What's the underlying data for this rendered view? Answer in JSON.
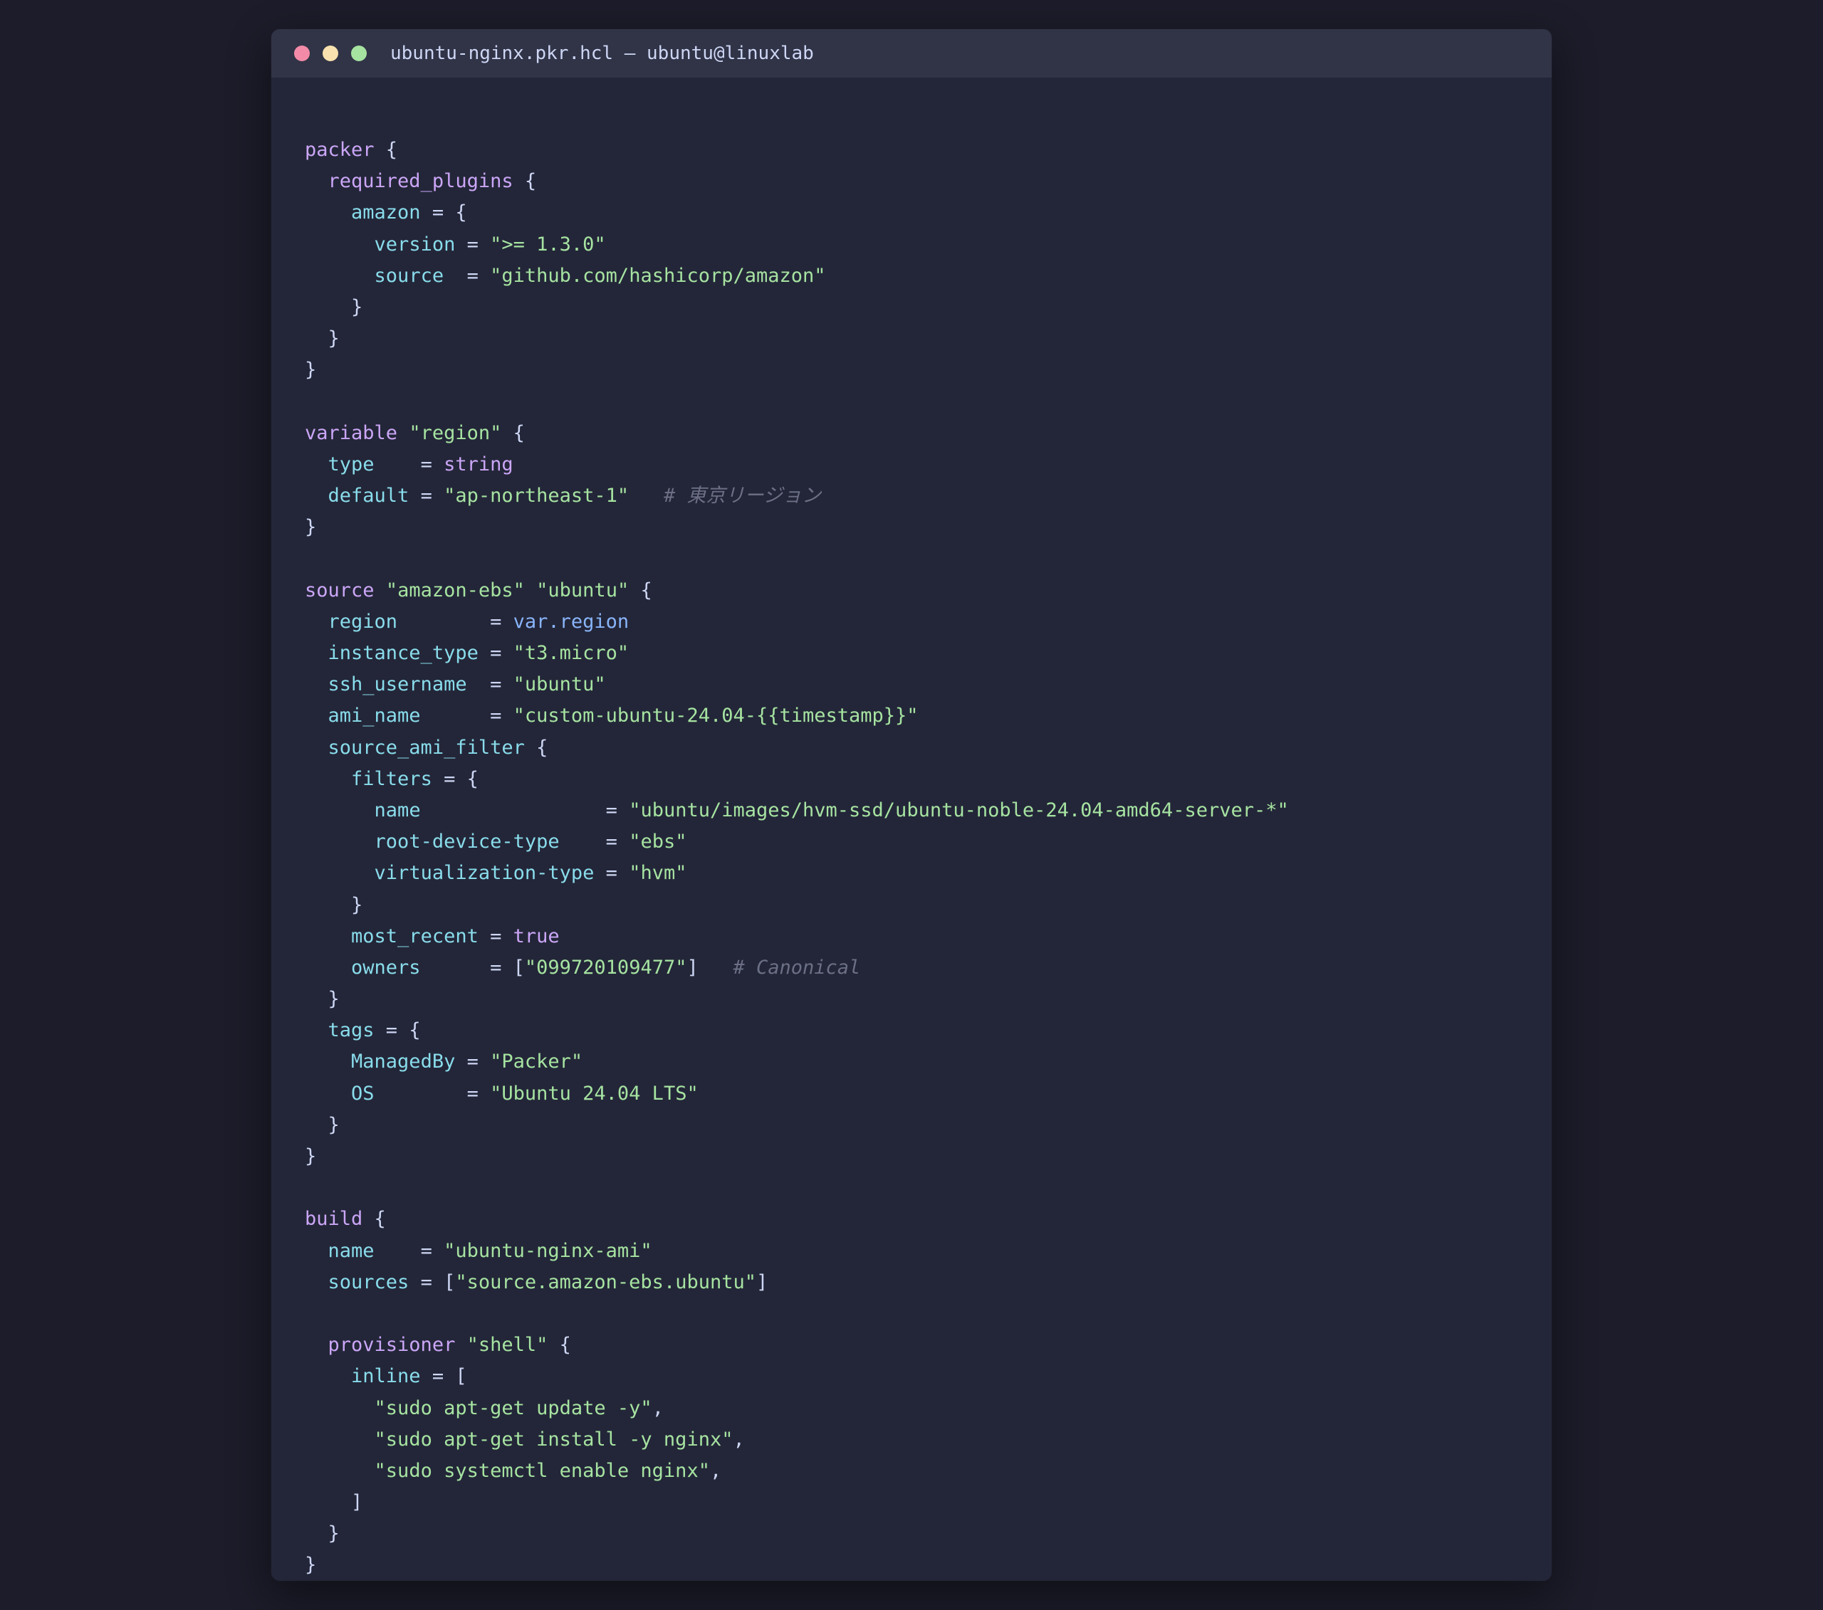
{
  "window": {
    "title": "ubuntu-nginx.pkr.hcl — ubuntu@linuxlab"
  },
  "colors": {
    "background": "#1c1c2a",
    "window": "#232638",
    "titlebar": "#313447",
    "keyword": "#cba6f7",
    "key": "#89dceb",
    "string": "#a6e3a1",
    "reference": "#89b4fa",
    "comment": "#6c7086",
    "text": "#cdd6f4"
  },
  "code": {
    "lines": [
      [
        {
          "t": "kw",
          "v": "packer"
        },
        {
          "t": "punct",
          "v": " {"
        }
      ],
      [
        {
          "t": "punct",
          "v": "  "
        },
        {
          "t": "kw",
          "v": "required_plugins"
        },
        {
          "t": "punct",
          "v": " {"
        }
      ],
      [
        {
          "t": "punct",
          "v": "    "
        },
        {
          "t": "key",
          "v": "amazon"
        },
        {
          "t": "punct",
          "v": " = {"
        }
      ],
      [
        {
          "t": "punct",
          "v": "      "
        },
        {
          "t": "key",
          "v": "version"
        },
        {
          "t": "punct",
          "v": " = "
        },
        {
          "t": "str",
          "v": "\">= 1.3.0\""
        }
      ],
      [
        {
          "t": "punct",
          "v": "      "
        },
        {
          "t": "key",
          "v": "source"
        },
        {
          "t": "punct",
          "v": "  = "
        },
        {
          "t": "str",
          "v": "\"github.com/hashicorp/amazon\""
        }
      ],
      [
        {
          "t": "punct",
          "v": "    }"
        }
      ],
      [
        {
          "t": "punct",
          "v": "  }"
        }
      ],
      [
        {
          "t": "punct",
          "v": "}"
        }
      ],
      [],
      [
        {
          "t": "kw",
          "v": "variable"
        },
        {
          "t": "punct",
          "v": " "
        },
        {
          "t": "str",
          "v": "\"region\""
        },
        {
          "t": "punct",
          "v": " {"
        }
      ],
      [
        {
          "t": "punct",
          "v": "  "
        },
        {
          "t": "key",
          "v": "type"
        },
        {
          "t": "punct",
          "v": "    = "
        },
        {
          "t": "kw",
          "v": "string"
        }
      ],
      [
        {
          "t": "punct",
          "v": "  "
        },
        {
          "t": "key",
          "v": "default"
        },
        {
          "t": "punct",
          "v": " = "
        },
        {
          "t": "str",
          "v": "\"ap-northeast-1\""
        },
        {
          "t": "punct",
          "v": "   "
        },
        {
          "t": "comment",
          "v": "# 東京リージョン"
        }
      ],
      [
        {
          "t": "punct",
          "v": "}"
        }
      ],
      [],
      [
        {
          "t": "kw",
          "v": "source"
        },
        {
          "t": "punct",
          "v": " "
        },
        {
          "t": "str",
          "v": "\"amazon-ebs\""
        },
        {
          "t": "punct",
          "v": " "
        },
        {
          "t": "str",
          "v": "\"ubuntu\""
        },
        {
          "t": "punct",
          "v": " {"
        }
      ],
      [
        {
          "t": "punct",
          "v": "  "
        },
        {
          "t": "key",
          "v": "region"
        },
        {
          "t": "punct",
          "v": "        = "
        },
        {
          "t": "ref",
          "v": "var.region"
        }
      ],
      [
        {
          "t": "punct",
          "v": "  "
        },
        {
          "t": "key",
          "v": "instance_type"
        },
        {
          "t": "punct",
          "v": " = "
        },
        {
          "t": "str",
          "v": "\"t3.micro\""
        }
      ],
      [
        {
          "t": "punct",
          "v": "  "
        },
        {
          "t": "key",
          "v": "ssh_username"
        },
        {
          "t": "punct",
          "v": "  = "
        },
        {
          "t": "str",
          "v": "\"ubuntu\""
        }
      ],
      [
        {
          "t": "punct",
          "v": "  "
        },
        {
          "t": "key",
          "v": "ami_name"
        },
        {
          "t": "punct",
          "v": "      = "
        },
        {
          "t": "str",
          "v": "\"custom-ubuntu-24.04-{{timestamp}}\""
        }
      ],
      [
        {
          "t": "punct",
          "v": "  "
        },
        {
          "t": "key",
          "v": "source_ami_filter"
        },
        {
          "t": "punct",
          "v": " {"
        }
      ],
      [
        {
          "t": "punct",
          "v": "    "
        },
        {
          "t": "key",
          "v": "filters"
        },
        {
          "t": "punct",
          "v": " = {"
        }
      ],
      [
        {
          "t": "punct",
          "v": "      "
        },
        {
          "t": "key",
          "v": "name"
        },
        {
          "t": "punct",
          "v": "                = "
        },
        {
          "t": "str",
          "v": "\"ubuntu/images/hvm-ssd/ubuntu-noble-24.04-amd64-server-*\""
        }
      ],
      [
        {
          "t": "punct",
          "v": "      "
        },
        {
          "t": "key",
          "v": "root-device-type"
        },
        {
          "t": "punct",
          "v": "    = "
        },
        {
          "t": "str",
          "v": "\"ebs\""
        }
      ],
      [
        {
          "t": "punct",
          "v": "      "
        },
        {
          "t": "key",
          "v": "virtualization-type"
        },
        {
          "t": "punct",
          "v": " = "
        },
        {
          "t": "str",
          "v": "\"hvm\""
        }
      ],
      [
        {
          "t": "punct",
          "v": "    }"
        }
      ],
      [
        {
          "t": "punct",
          "v": "    "
        },
        {
          "t": "key",
          "v": "most_recent"
        },
        {
          "t": "punct",
          "v": " = "
        },
        {
          "t": "bool",
          "v": "true"
        }
      ],
      [
        {
          "t": "punct",
          "v": "    "
        },
        {
          "t": "key",
          "v": "owners"
        },
        {
          "t": "punct",
          "v": "      = ["
        },
        {
          "t": "str",
          "v": "\"099720109477\""
        },
        {
          "t": "punct",
          "v": "]   "
        },
        {
          "t": "comment",
          "v": "# Canonical"
        }
      ],
      [
        {
          "t": "punct",
          "v": "  }"
        }
      ],
      [
        {
          "t": "punct",
          "v": "  "
        },
        {
          "t": "key",
          "v": "tags"
        },
        {
          "t": "punct",
          "v": " = {"
        }
      ],
      [
        {
          "t": "punct",
          "v": "    "
        },
        {
          "t": "key",
          "v": "ManagedBy"
        },
        {
          "t": "punct",
          "v": " = "
        },
        {
          "t": "str",
          "v": "\"Packer\""
        }
      ],
      [
        {
          "t": "punct",
          "v": "    "
        },
        {
          "t": "key",
          "v": "OS"
        },
        {
          "t": "punct",
          "v": "        = "
        },
        {
          "t": "str",
          "v": "\"Ubuntu 24.04 LTS\""
        }
      ],
      [
        {
          "t": "punct",
          "v": "  }"
        }
      ],
      [
        {
          "t": "punct",
          "v": "}"
        }
      ],
      [],
      [
        {
          "t": "kw",
          "v": "build"
        },
        {
          "t": "punct",
          "v": " {"
        }
      ],
      [
        {
          "t": "punct",
          "v": "  "
        },
        {
          "t": "key",
          "v": "name"
        },
        {
          "t": "punct",
          "v": "    = "
        },
        {
          "t": "str",
          "v": "\"ubuntu-nginx-ami\""
        }
      ],
      [
        {
          "t": "punct",
          "v": "  "
        },
        {
          "t": "key",
          "v": "sources"
        },
        {
          "t": "punct",
          "v": " = ["
        },
        {
          "t": "str",
          "v": "\"source.amazon-ebs.ubuntu\""
        },
        {
          "t": "punct",
          "v": "]"
        }
      ],
      [],
      [
        {
          "t": "punct",
          "v": "  "
        },
        {
          "t": "kw",
          "v": "provisioner"
        },
        {
          "t": "punct",
          "v": " "
        },
        {
          "t": "str",
          "v": "\"shell\""
        },
        {
          "t": "punct",
          "v": " {"
        }
      ],
      [
        {
          "t": "punct",
          "v": "    "
        },
        {
          "t": "key",
          "v": "inline"
        },
        {
          "t": "punct",
          "v": " = ["
        }
      ],
      [
        {
          "t": "punct",
          "v": "      "
        },
        {
          "t": "str",
          "v": "\"sudo apt-get update -y\""
        },
        {
          "t": "punct",
          "v": ","
        }
      ],
      [
        {
          "t": "punct",
          "v": "      "
        },
        {
          "t": "str",
          "v": "\"sudo apt-get install -y nginx\""
        },
        {
          "t": "punct",
          "v": ","
        }
      ],
      [
        {
          "t": "punct",
          "v": "      "
        },
        {
          "t": "str",
          "v": "\"sudo systemctl enable nginx\""
        },
        {
          "t": "punct",
          "v": ","
        }
      ],
      [
        {
          "t": "punct",
          "v": "    ]"
        }
      ],
      [
        {
          "t": "punct",
          "v": "  }"
        }
      ],
      [
        {
          "t": "punct",
          "v": "}"
        }
      ]
    ]
  }
}
